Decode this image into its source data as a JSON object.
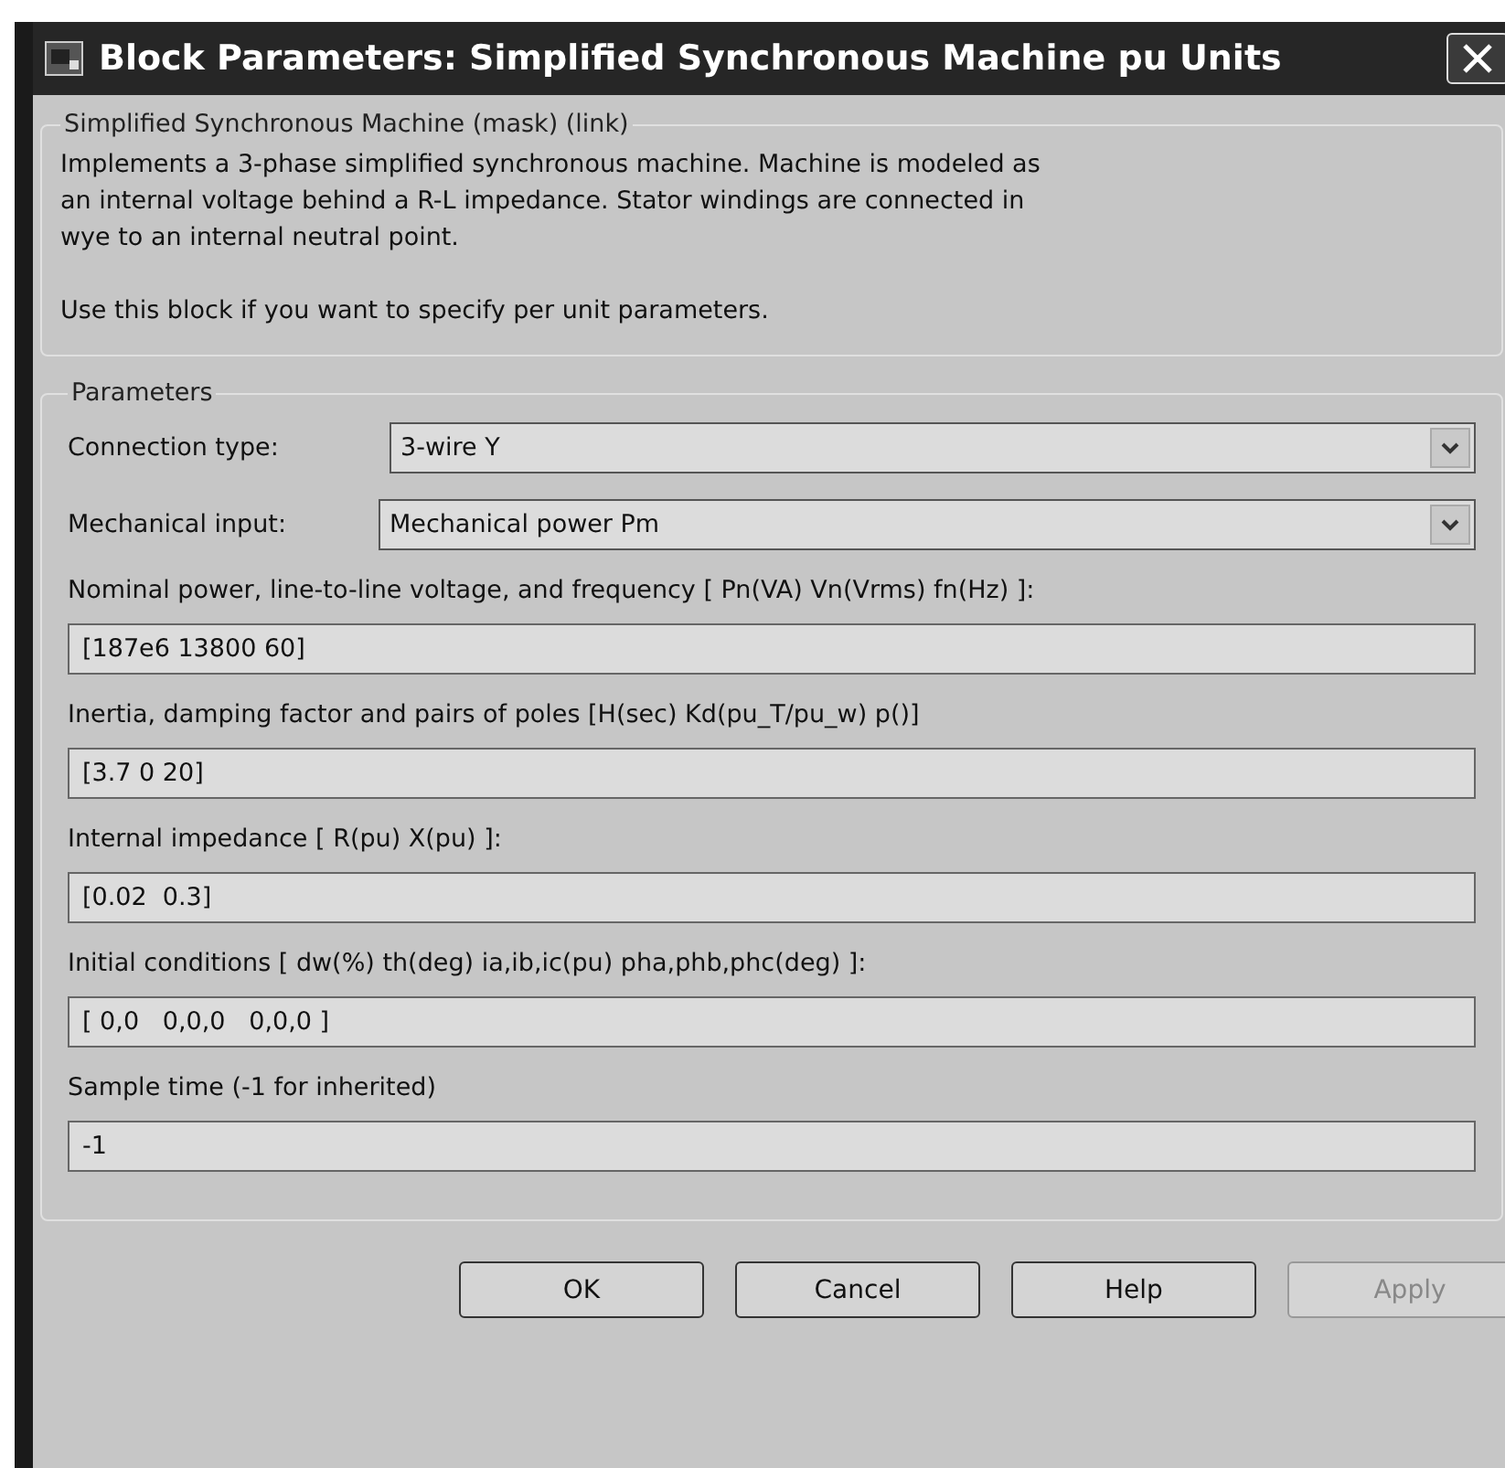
{
  "window": {
    "title": "Block Parameters: Simplified Synchronous Machine pu Units"
  },
  "description_group": {
    "legend": "Simplified Synchronous Machine (mask) (link)",
    "paragraphs": [
      "Implements a 3-phase simplified synchronous machine. Machine is modeled as an internal voltage behind a R-L impedance. Stator windings are connected in wye to an internal neutral point.",
      "Use this block if you want to specify per unit parameters."
    ]
  },
  "parameters_group": {
    "legend": "Parameters",
    "dropdowns": [
      {
        "label": "Connection type:",
        "value": "3-wire Y"
      },
      {
        "label": "Mechanical input:",
        "value": "Mechanical power Pm"
      }
    ],
    "fields": [
      {
        "label": "Nominal power, line-to-line voltage, and frequency [ Pn(VA) Vn(Vrms) fn(Hz) ]:",
        "value": "[187e6 13800 60]"
      },
      {
        "label": "Inertia, damping factor and pairs of poles [H(sec) Kd(pu_T/pu_w) p()]",
        "value": "[3.7 0 20]"
      },
      {
        "label": "Internal impedance [ R(pu)  X(pu) ]:",
        "value": "[0.02  0.3]"
      },
      {
        "label": "Initial conditions [ dw(%)  th(deg)  ia,ib,ic(pu)  pha,phb,phc(deg) ]:",
        "value": "[ 0,0   0,0,0   0,0,0 ]"
      },
      {
        "label": "Sample time (-1 for inherited)",
        "value": "-1"
      }
    ]
  },
  "buttons": [
    {
      "label": "OK",
      "disabled": false
    },
    {
      "label": "Cancel",
      "disabled": false
    },
    {
      "label": "Help",
      "disabled": false
    },
    {
      "label": "Apply",
      "disabled": true
    }
  ]
}
